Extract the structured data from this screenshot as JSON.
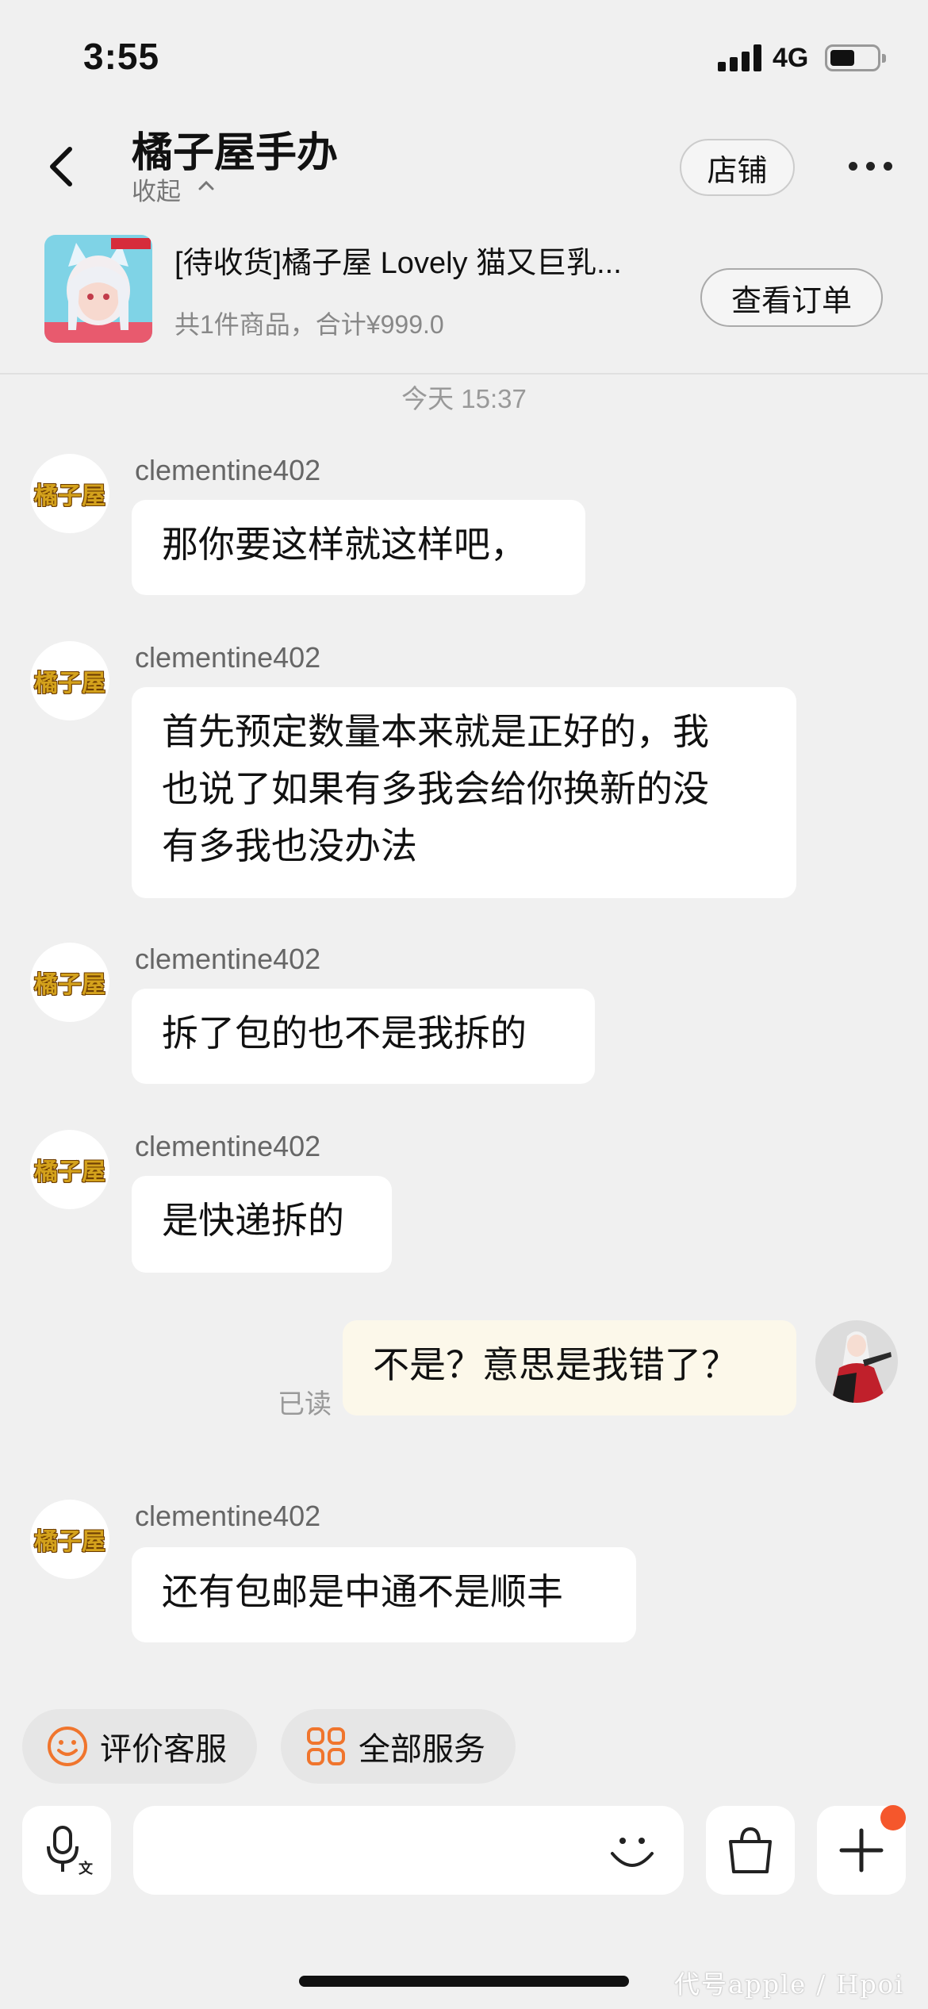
{
  "status_bar": {
    "time": "3:55",
    "network": "4G"
  },
  "header": {
    "title": "橘子屋手办",
    "collapse_label": "收起",
    "store_button": "店铺"
  },
  "order": {
    "title": "[待收货]橘子屋 Lovely 猫又巨乳...",
    "summary": "共1件商品，合计¥999.0",
    "view_button": "查看订单",
    "thumbnail_tag": "橘子屋手办"
  },
  "chat": {
    "timestamp": "今天 15:37",
    "shop_avatar_text": "橘子屋",
    "messages": [
      {
        "sender": "clementine402",
        "text": "那你要这样就这样吧，"
      },
      {
        "sender": "clementine402",
        "lines": [
          "首先预定数量本来就是正好的，我",
          "也说了如果有多我会给你换新的没",
          "有多我也没办法"
        ]
      },
      {
        "sender": "clementine402",
        "text": "拆了包的也不是我拆的"
      },
      {
        "sender": "clementine402",
        "text": "是快递拆的"
      },
      {
        "sender": "me",
        "text": "不是？意思是我错了？",
        "status": "已读"
      },
      {
        "sender": "clementine402",
        "text": "还有包邮是中通不是顺丰"
      }
    ]
  },
  "quick_actions": [
    {
      "label": "评价客服",
      "icon": "smile-icon"
    },
    {
      "label": "全部服务",
      "icon": "grid-icon"
    }
  ],
  "colors": {
    "accent": "#f5572c",
    "chip_icon": "#f0752d",
    "my_bubble": "#fcf8ea"
  },
  "watermark": "代号apple / Hpoi"
}
